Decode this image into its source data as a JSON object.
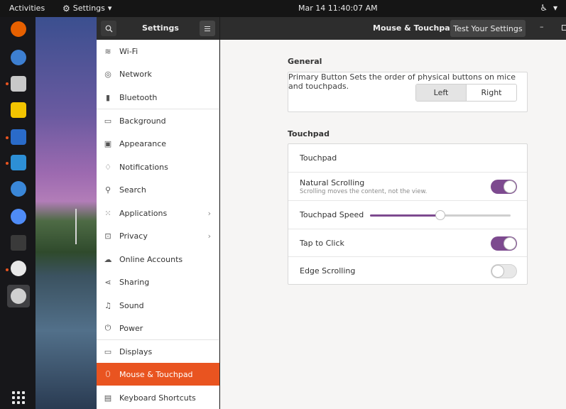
{
  "topbar": {
    "activities": "Activities",
    "app_menu": "Settings",
    "clock": "Mar 14  11:40:07 AM"
  },
  "dock": {
    "items": [
      {
        "name": "firefox",
        "color": "#e66000"
      },
      {
        "name": "thunderbird",
        "color": "#3d7fd1"
      },
      {
        "name": "files",
        "color": "#c8c8c8"
      },
      {
        "name": "rhythmbox",
        "color": "#f2c400"
      },
      {
        "name": "writer",
        "color": "#2a6bc9"
      },
      {
        "name": "software",
        "color": "#2d8fd6"
      },
      {
        "name": "help",
        "color": "#3a87d8"
      },
      {
        "name": "chromium",
        "color": "#4f8cf7"
      },
      {
        "name": "terminal",
        "color": "#3a3a3a"
      },
      {
        "name": "messaging",
        "color": "#e8e8e8"
      },
      {
        "name": "settings",
        "color": "#d0d0d0"
      }
    ]
  },
  "header": {
    "sidebar_title": "Settings",
    "page_title": "Mouse & Touchpad",
    "test_button": "Test Your Settings",
    "minimize": "–"
  },
  "sidebar": {
    "items": [
      {
        "label": "Wi-Fi",
        "icon": "wifi-icon"
      },
      {
        "label": "Network",
        "icon": "network-icon"
      },
      {
        "label": "Bluetooth",
        "icon": "bluetooth-icon"
      },
      {
        "label": "Background",
        "icon": "background-icon"
      },
      {
        "label": "Appearance",
        "icon": "appearance-icon"
      },
      {
        "label": "Notifications",
        "icon": "bell-icon"
      },
      {
        "label": "Search",
        "icon": "search-icon"
      },
      {
        "label": "Applications",
        "icon": "grid-icon",
        "chevron": true
      },
      {
        "label": "Privacy",
        "icon": "lock-icon",
        "chevron": true
      },
      {
        "label": "Online Accounts",
        "icon": "cloud-icon"
      },
      {
        "label": "Sharing",
        "icon": "share-icon"
      },
      {
        "label": "Sound",
        "icon": "music-icon"
      },
      {
        "label": "Power",
        "icon": "power-icon"
      },
      {
        "label": "Displays",
        "icon": "display-icon"
      },
      {
        "label": "Mouse & Touchpad",
        "icon": "mouse-icon",
        "active": true
      },
      {
        "label": "Keyboard Shortcuts",
        "icon": "keyboard-icon"
      }
    ]
  },
  "general": {
    "title": "General",
    "primary_button": {
      "label": "Primary Button",
      "description_line1": "Sets the order of physical buttons",
      "description_line2": "on mice and touchpads.",
      "left": "Left",
      "right": "Right",
      "selected": "Left"
    }
  },
  "touchpad": {
    "title": "Touchpad",
    "touchpad_label": "Touchpad",
    "natural_scrolling": {
      "label": "Natural Scrolling",
      "description": "Scrolling moves the content, not the view.",
      "on": true
    },
    "speed": {
      "label": "Touchpad Speed",
      "value": 0.5
    },
    "tap_to_click": {
      "label": "Tap to Click",
      "on": true
    },
    "edge_scrolling": {
      "label": "Edge Scrolling",
      "on": false
    }
  },
  "colors": {
    "accent": "#e95420",
    "toggle_on": "#7d4a8f"
  }
}
